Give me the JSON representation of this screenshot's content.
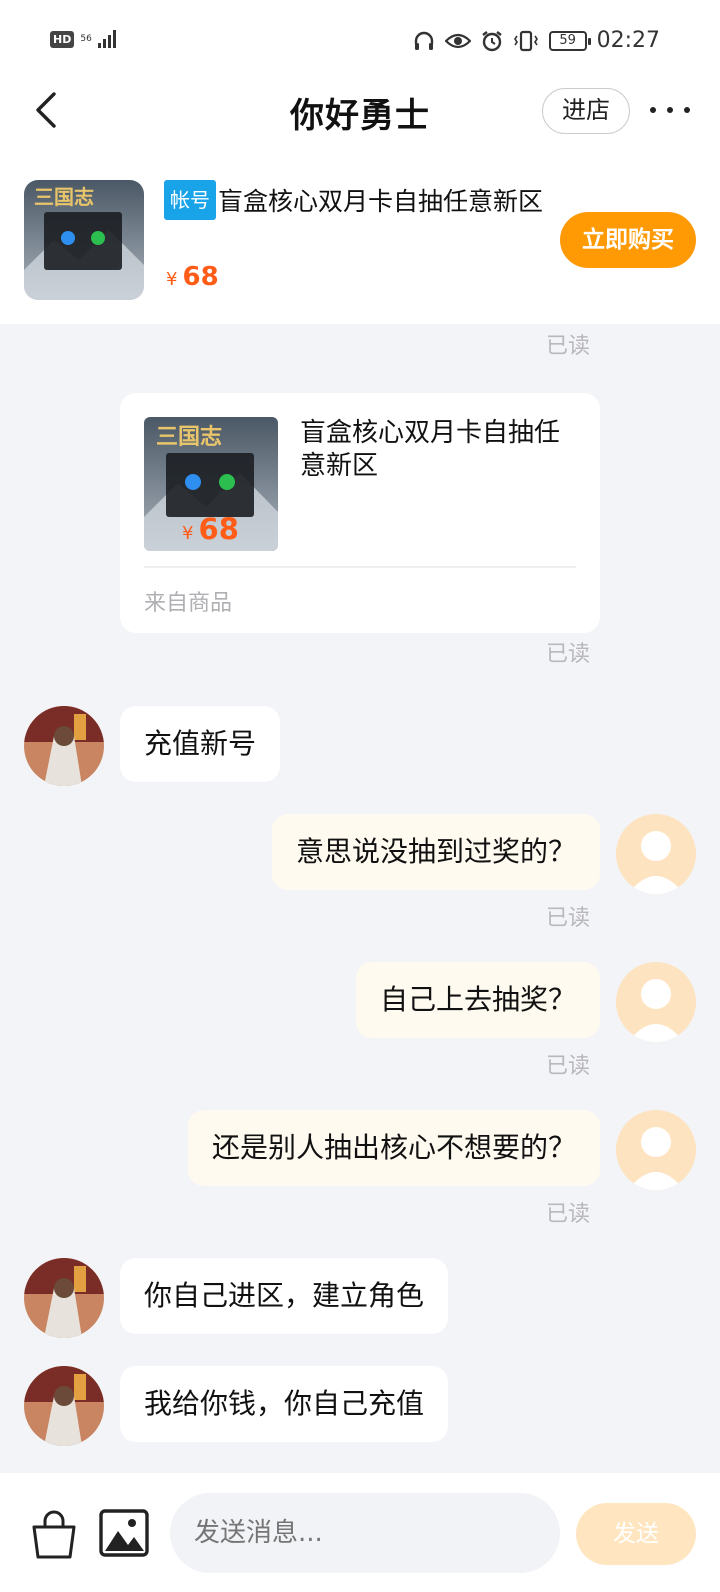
{
  "status_bar": {
    "left_badge": "HD",
    "network": "56",
    "battery": "59",
    "time": "02:27"
  },
  "header": {
    "title": "你好勇士",
    "shop_button": "进店"
  },
  "product": {
    "tag": "帐号",
    "title": "盲盒核心双月卡自抽任意新区",
    "currency": "¥",
    "price": "68",
    "buy_button": "立即购买"
  },
  "chat": {
    "read_label": "已读",
    "product_card": {
      "title": "盲盒核心双月卡自抽任意新区",
      "currency": "¥",
      "price": "68",
      "source": "来自商品"
    },
    "messages": [
      {
        "side": "left",
        "text": "充值新号"
      },
      {
        "side": "right",
        "text": "意思说没抽到过奖的？"
      },
      {
        "side": "right",
        "text": "自己上去抽奖？"
      },
      {
        "side": "right",
        "text": "还是别人抽出核心不想要的？"
      },
      {
        "side": "left",
        "text": "你自己进区，建立角色"
      },
      {
        "side": "left",
        "text": "我给你钱，你自己充值"
      }
    ]
  },
  "input_bar": {
    "placeholder": "发送消息...",
    "send_button": "发送"
  },
  "colors": {
    "accent_orange": "#ff9a05",
    "price_orange": "#ff5c17",
    "tag_blue": "#19a3e8",
    "send_disabled": "#ffe5c0"
  }
}
